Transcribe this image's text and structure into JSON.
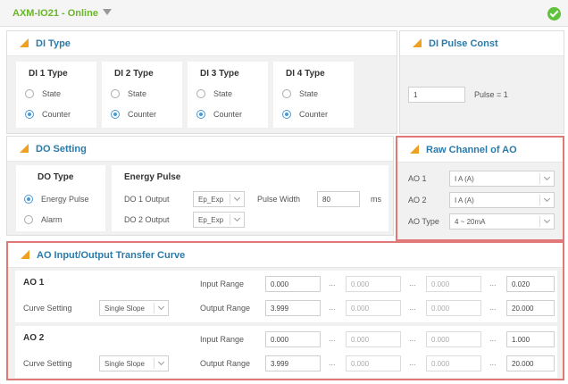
{
  "header": {
    "device": "AXM-IO21 - Online"
  },
  "di_type": {
    "title": "DI Type",
    "cards": [
      {
        "label": "DI 1 Type",
        "opt1": "State",
        "opt2": "Counter",
        "selected": "Counter"
      },
      {
        "label": "DI 2 Type",
        "opt1": "State",
        "opt2": "Counter",
        "selected": "Counter"
      },
      {
        "label": "DI 3 Type",
        "opt1": "State",
        "opt2": "Counter",
        "selected": "Counter"
      },
      {
        "label": "DI 4 Type",
        "opt1": "State",
        "opt2": "Counter",
        "selected": "Counter"
      }
    ]
  },
  "di_pulse": {
    "title": "DI Pulse Const",
    "value": "1",
    "text": "Pulse = 1"
  },
  "do_setting": {
    "title": "DO Setting",
    "do_type_label": "DO Type",
    "opt_energy": "Energy Pulse",
    "opt_alarm": "Alarm",
    "selected": "Energy Pulse",
    "energy_label": "Energy Pulse",
    "do1_label": "DO 1 Output",
    "do1_value": "Ep_Exp",
    "do2_label": "DO 2 Output",
    "do2_value": "Ep_Exp",
    "pw_label": "Pulse Width",
    "pw_value": "80",
    "pw_unit": "ms"
  },
  "raw_ao": {
    "title": "Raw Channel of AO",
    "ao1_label": "AO 1",
    "ao1_value": "I A (A)",
    "ao2_label": "AO 2",
    "ao2_value": "I A (A)",
    "type_label": "AO Type",
    "type_value": "4 ~ 20mA"
  },
  "curve": {
    "title": "AO Input/Output Transfer Curve",
    "ellipsis": "...",
    "ao1": {
      "label": "AO 1",
      "setting_label": "Curve Setting",
      "setting_value": "Single Slope",
      "input_label": "Input Range",
      "inputs": [
        "0.000",
        "0.000",
        "0.000",
        "0.020"
      ],
      "output_label": "Output Range",
      "outputs": [
        "3.999",
        "0.000",
        "0.000",
        "20.000"
      ]
    },
    "ao2": {
      "label": "AO 2",
      "setting_label": "Curve Setting",
      "setting_value": "Single Slope",
      "input_label": "Input Range",
      "inputs": [
        "0.000",
        "0.000",
        "0.000",
        "1.000"
      ],
      "output_label": "Output Range",
      "outputs": [
        "3.999",
        "0.000",
        "0.000",
        "20.000"
      ]
    }
  },
  "colors": {
    "accent": "#6bb52b",
    "title_blue": "#2a7aaa",
    "highlight": "#e07878",
    "radio": "#4a9ad6",
    "triangle": "#f0a020"
  }
}
